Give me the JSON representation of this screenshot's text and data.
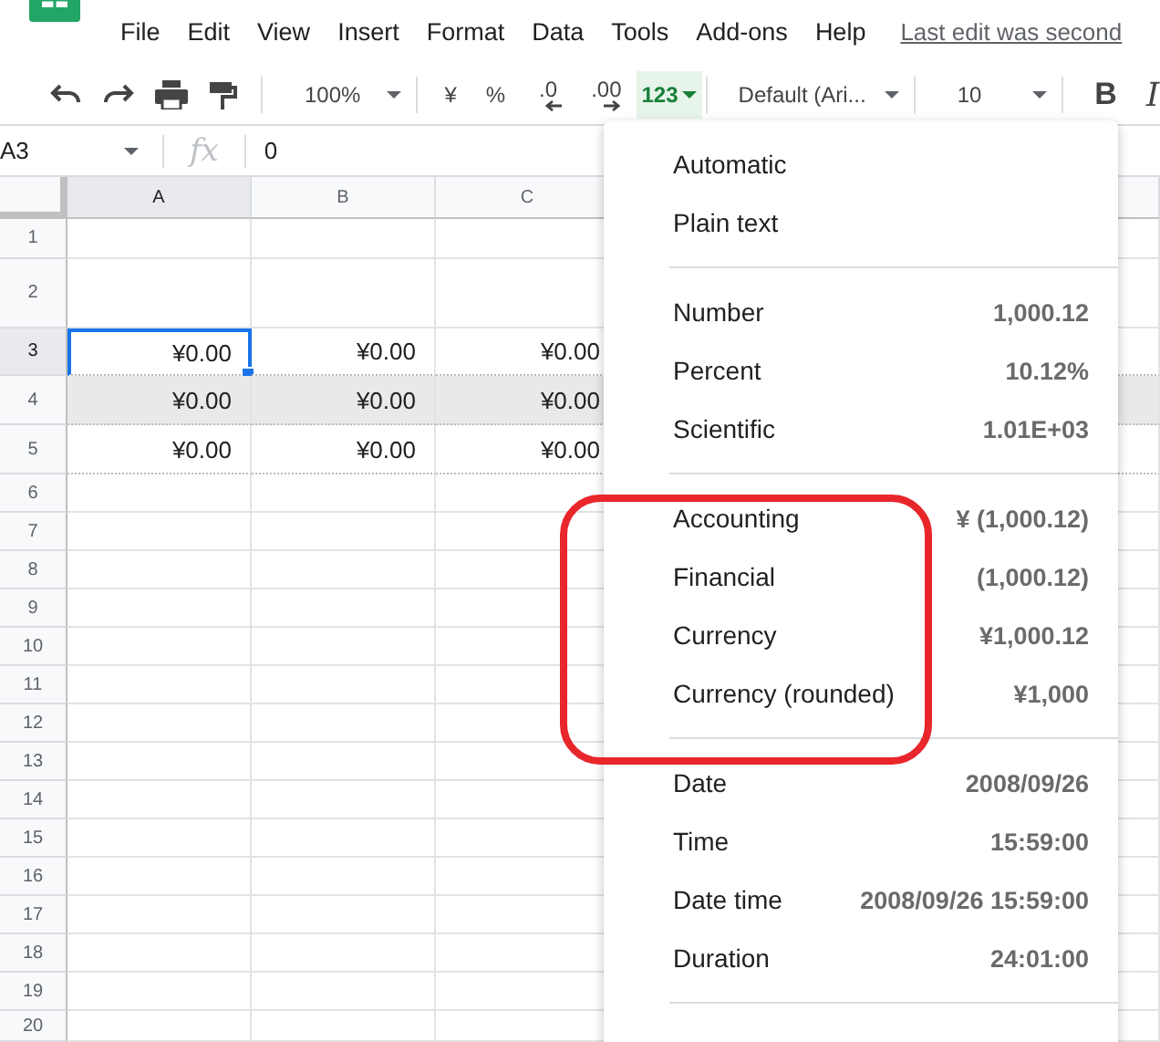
{
  "menubar": {
    "items": [
      "File",
      "Edit",
      "View",
      "Insert",
      "Format",
      "Data",
      "Tools",
      "Add-ons",
      "Help"
    ],
    "last_edit": "Last edit was second"
  },
  "toolbar": {
    "zoom": "100%",
    "currency": "¥",
    "percent": "%",
    "decrease_decimals": ".0",
    "increase_decimals": ".00",
    "more_formats": {
      "label": "123",
      "selected": true
    },
    "font": "Default (Ari...",
    "font_size": "10",
    "bold": "B",
    "italic": "I"
  },
  "formula_bar": {
    "cell_ref": "A3",
    "fx": "fx",
    "value": "0"
  },
  "sheet": {
    "columns": [
      {
        "label": "A",
        "selected": true
      },
      {
        "label": "B",
        "selected": false
      },
      {
        "label": "C",
        "selected": false
      }
    ],
    "rows": [
      {
        "label": "1",
        "selected": false,
        "highlighted": false,
        "cells": []
      },
      {
        "label": "2",
        "selected": false,
        "highlighted": false,
        "cells": []
      },
      {
        "label": "3",
        "selected": true,
        "highlighted": false,
        "cells": [
          {
            "value": "¥0.00",
            "selected": true
          },
          {
            "value": "¥0.00",
            "selected": false
          },
          {
            "value": "¥0.00",
            "selected": false
          }
        ]
      },
      {
        "label": "4",
        "selected": false,
        "highlighted": true,
        "cells": [
          {
            "value": "¥0.00",
            "selected": false
          },
          {
            "value": "¥0.00",
            "selected": false
          },
          {
            "value": "¥0.00",
            "selected": false
          }
        ]
      },
      {
        "label": "5",
        "selected": false,
        "highlighted": false,
        "cells": [
          {
            "value": "¥0.00",
            "selected": false
          },
          {
            "value": "¥0.00",
            "selected": false
          },
          {
            "value": "¥0.00",
            "selected": false
          }
        ]
      },
      {
        "label": "6",
        "selected": false,
        "highlighted": false,
        "cells": []
      },
      {
        "label": "7",
        "selected": false,
        "highlighted": false,
        "cells": []
      },
      {
        "label": "8",
        "selected": false,
        "highlighted": false,
        "cells": []
      },
      {
        "label": "9",
        "selected": false,
        "highlighted": false,
        "cells": []
      },
      {
        "label": "10",
        "selected": false,
        "highlighted": false,
        "cells": []
      },
      {
        "label": "11",
        "selected": false,
        "highlighted": false,
        "cells": []
      },
      {
        "label": "12",
        "selected": false,
        "highlighted": false,
        "cells": []
      },
      {
        "label": "13",
        "selected": false,
        "highlighted": false,
        "cells": []
      },
      {
        "label": "14",
        "selected": false,
        "highlighted": false,
        "cells": []
      },
      {
        "label": "15",
        "selected": false,
        "highlighted": false,
        "cells": []
      },
      {
        "label": "16",
        "selected": false,
        "highlighted": false,
        "cells": []
      },
      {
        "label": "17",
        "selected": false,
        "highlighted": false,
        "cells": []
      },
      {
        "label": "18",
        "selected": false,
        "highlighted": false,
        "cells": []
      },
      {
        "label": "19",
        "selected": false,
        "highlighted": false,
        "cells": []
      },
      {
        "label": "20",
        "selected": false,
        "highlighted": false,
        "cells": []
      }
    ]
  },
  "format_menu": {
    "groups": [
      [
        {
          "label": "Automatic"
        },
        {
          "label": "Plain text"
        }
      ],
      [
        {
          "label": "Number",
          "example": "1,000.12"
        },
        {
          "label": "Percent",
          "example": "10.12%"
        },
        {
          "label": "Scientific",
          "example": "1.01E+03"
        }
      ],
      [
        {
          "label": "Accounting",
          "example": "¥ (1,000.12)"
        },
        {
          "label": "Financial",
          "example": "(1,000.12)"
        },
        {
          "label": "Currency",
          "example": "¥1,000.12"
        },
        {
          "label": "Currency (rounded)",
          "example": "¥1,000"
        }
      ],
      [
        {
          "label": "Date",
          "example": "2008/09/26"
        },
        {
          "label": "Time",
          "example": "15:59:00"
        },
        {
          "label": "Date time",
          "example": "2008/09/26 15:59:00"
        },
        {
          "label": "Duration",
          "example": "24:01:00"
        }
      ]
    ]
  }
}
